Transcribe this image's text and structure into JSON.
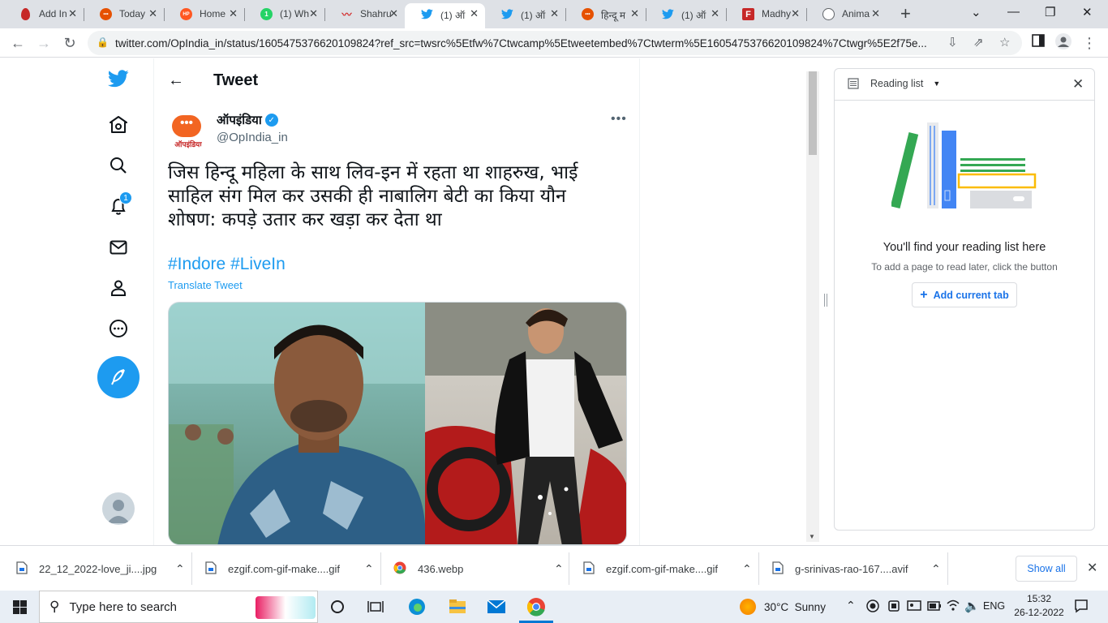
{
  "browser": {
    "tabs": [
      {
        "title": "Add In",
        "icon": "drop-icon",
        "color": "#c62828",
        "active": false
      },
      {
        "title": "Today",
        "icon": "op-icon",
        "color": "#e65100",
        "active": false
      },
      {
        "title": "Home",
        "icon": "hp-icon",
        "color": "#ff5722",
        "active": false
      },
      {
        "title": "(1) Wh",
        "icon": "whatsapp-icon",
        "color": "#25d366",
        "active": false
      },
      {
        "title": "Shahru",
        "icon": "feather-icon",
        "color": "#d32f2f",
        "active": false
      },
      {
        "title": "(1) ऑ",
        "icon": "twitter-icon",
        "color": "#1d9bf0",
        "active": true
      },
      {
        "title": "(1) ऑ",
        "icon": "twitter-icon",
        "color": "#1d9bf0",
        "active": false
      },
      {
        "title": "हिन्दू म",
        "icon": "op-icon",
        "color": "#e65100",
        "active": false
      },
      {
        "title": "(1) ऑ",
        "icon": "twitter-icon",
        "color": "#1d9bf0",
        "active": false
      },
      {
        "title": "Madhy",
        "icon": "f-icon",
        "color": "#c62828",
        "active": false
      },
      {
        "title": "Anima",
        "icon": "globe-icon",
        "color": "#5f6368",
        "active": false
      }
    ],
    "url": "twitter.com/OpIndia_in/status/1605475376620109824?ref_src=twsrc%5Etfw%7Ctwcamp%5Etweetembed%7Ctwterm%5E1605475376620109824%7Ctwgr%5E2f75e..."
  },
  "twitter": {
    "notification_count": "1",
    "header_title": "Tweet",
    "author_name": "ऑपइंडिया",
    "author_handle": "@OpIndia_in",
    "avatar_text": "ऑपइंडिया",
    "tweet_text": "जिस हिन्दू महिला के साथ लिव-इन में रहता था शाहरुख, भाई साहिल संग मिल कर उसकी ही नाबालिग बेटी का किया यौन शोषण: कपड़े उतार कर खड़ा कर देता था",
    "hashtag1": "#Indore",
    "hashtag2": "#LiveIn",
    "translate": "Translate Tweet"
  },
  "reading_list": {
    "title": "Reading list",
    "heading": "You'll find your reading list here",
    "subtext": "To add a page to read later, click the button",
    "button": "Add current tab"
  },
  "downloads": {
    "items": [
      "22_12_2022-love_ji....jpg",
      "ezgif.com-gif-make....gif",
      "436.webp",
      "ezgif.com-gif-make....gif",
      "g-srinivas-rao-167....avif"
    ],
    "show_all": "Show all"
  },
  "taskbar": {
    "search_placeholder": "Type here to search",
    "weather": "30°C  Sunny",
    "lang": "ENG",
    "time": "15:32",
    "date": "26-12-2022"
  }
}
